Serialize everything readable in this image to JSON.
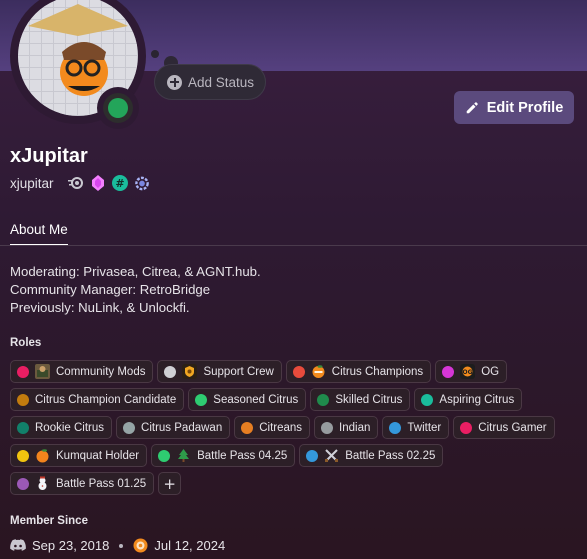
{
  "profile": {
    "display_name": "xJupitar",
    "username": "xjupitar",
    "status_color": "#23a55a",
    "add_status_label": "Add Status",
    "edit_profile_label": "Edit Profile",
    "badges": [
      "nitro-icon",
      "gem-boost-icon",
      "hashtag-badge-icon",
      "quest-badge-icon"
    ]
  },
  "tabs": [
    {
      "label": "About Me"
    }
  ],
  "about": {
    "lines": [
      "Moderating: Privasea, Citrea, & AGNT.hub.",
      "Community Manager: RetroBridge",
      "Previously: NuLink, & Unlockfi."
    ]
  },
  "roles": {
    "title": "Roles",
    "items": [
      {
        "label": "Community Mods",
        "color": "#e91e63",
        "icon": "mod-image-icon"
      },
      {
        "label": "Support Crew",
        "color": "#cfd0d4",
        "icon": "shield-icon"
      },
      {
        "label": "Citrus Champions",
        "color": "#e84b3c",
        "icon": "orange-icon"
      },
      {
        "label": "OG",
        "color": "#d636d6",
        "icon": "og-icon"
      },
      {
        "label": "Citrus Champion Candidate",
        "color": "#c27c0e",
        "icon": ""
      },
      {
        "label": "Seasoned Citrus",
        "color": "#2ecc71",
        "icon": ""
      },
      {
        "label": "Skilled Citrus",
        "color": "#1f8b4c",
        "icon": ""
      },
      {
        "label": "Aspiring Citrus",
        "color": "#1abc9c",
        "icon": ""
      },
      {
        "label": "Rookie Citrus",
        "color": "#11806a",
        "icon": ""
      },
      {
        "label": "Citrus Padawan",
        "color": "#95a5a6",
        "icon": ""
      },
      {
        "label": "Citreans",
        "color": "#e67e22",
        "icon": ""
      },
      {
        "label": "Indian",
        "color": "#979c9f",
        "icon": ""
      },
      {
        "label": "Twitter",
        "color": "#3498db",
        "icon": ""
      },
      {
        "label": "Citrus Gamer",
        "color": "#e91e63",
        "icon": ""
      },
      {
        "label": "Kumquat Holder",
        "color": "#f1c40f",
        "icon": "kumquat-icon"
      },
      {
        "label": "Battle Pass 04.25",
        "color": "#2ecc71",
        "icon": "tree-icon"
      },
      {
        "label": "Battle Pass 02.25",
        "color": "#3498db",
        "icon": "swords-icon"
      },
      {
        "label": "Battle Pass 01.25",
        "color": "#9b59b6",
        "icon": "snowman-icon"
      }
    ]
  },
  "member_since": {
    "title": "Member Since",
    "discord_date": "Sep 23, 2018",
    "server_date": "Jul 12, 2024"
  },
  "colors": {
    "accent": "#5b4a7d",
    "banner": "#4b3a74",
    "online": "#23a55a"
  }
}
